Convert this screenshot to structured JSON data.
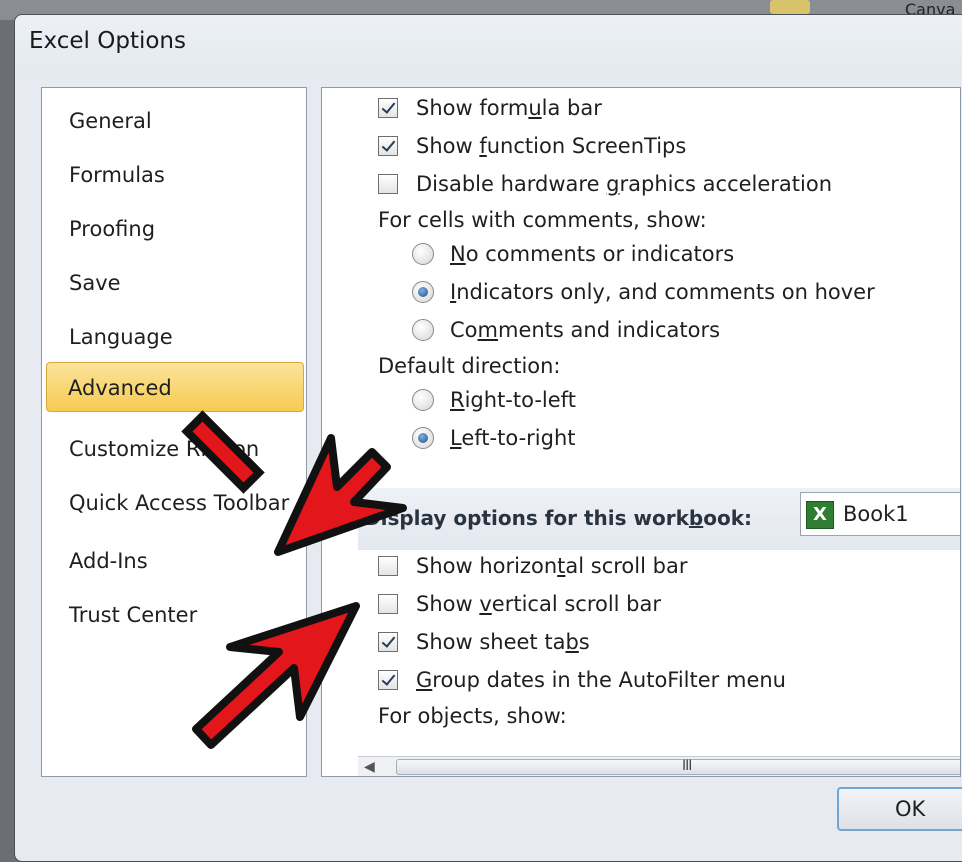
{
  "background": {
    "partial_text": "Canva"
  },
  "dialog": {
    "title": "Excel Options"
  },
  "nav": {
    "items": [
      {
        "label": "General",
        "selected": false
      },
      {
        "label": "Formulas",
        "selected": false
      },
      {
        "label": "Proofing",
        "selected": false
      },
      {
        "label": "Save",
        "selected": false
      },
      {
        "label": "Language",
        "selected": false
      },
      {
        "label": "Advanced",
        "selected": true
      },
      {
        "label": "Customize Ribbon",
        "selected": false
      },
      {
        "label": "Quick Access Toolbar",
        "selected": false
      },
      {
        "label": "Add-Ins",
        "selected": false
      },
      {
        "label": "Trust Center",
        "selected": false
      }
    ]
  },
  "options": {
    "show_formula_bar": {
      "pre": "Show form",
      "u": "u",
      "post": "la bar",
      "checked": true
    },
    "show_function_screentips": {
      "pre": "Show ",
      "u": "f",
      "post": "unction ScreenTips",
      "checked": true
    },
    "disable_hw_graphics": {
      "pre": "Disable hardware ",
      "u": "g",
      "post": "raphics acceleration",
      "checked": false
    },
    "comments_heading": "For cells with comments, show:",
    "comments_none": {
      "pre": "",
      "u": "N",
      "post": "o comments or indicators",
      "checked": false
    },
    "comments_indicators": {
      "pre": "",
      "u": "I",
      "post": "ndicators only, and comments on hover",
      "checked": true
    },
    "comments_both": {
      "pre": "Co",
      "u": "m",
      "post": "ments and indicators",
      "checked": false
    },
    "direction_heading": "Default direction:",
    "direction_rtl": {
      "pre": "",
      "u": "R",
      "post": "ight-to-left",
      "checked": false
    },
    "direction_ltr": {
      "pre": "",
      "u": "L",
      "post": "eft-to-right",
      "checked": true
    },
    "workbook_section": {
      "pre": "Display options for this work",
      "u": "b",
      "post": "ook:",
      "workbook": "Book1",
      "icon": "excel-workbook-icon"
    },
    "show_hscroll": {
      "pre": "Show horizon",
      "u": "t",
      "post": "al scroll bar",
      "checked": false
    },
    "show_vscroll": {
      "pre": "Show ",
      "u": "v",
      "post": "ertical scroll bar",
      "checked": false
    },
    "show_sheet_tabs": {
      "pre": "Show sheet ta",
      "u": "b",
      "post": "s",
      "checked": true
    },
    "group_dates": {
      "pre": "",
      "u": "G",
      "post": "roup dates in the AutoFilter menu",
      "checked": true
    },
    "objects_heading": "For objects, show:"
  },
  "scrollbar": {
    "grip": "III"
  },
  "buttons": {
    "ok": "OK"
  },
  "colors": {
    "selected_nav": "#f6cb52",
    "arrow": "#e3161c",
    "ok_border": "#6fa6d6"
  }
}
